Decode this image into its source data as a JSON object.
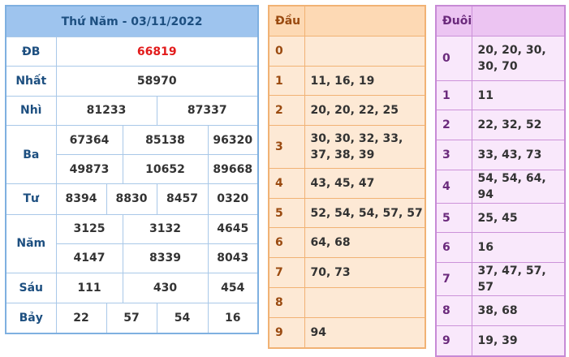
{
  "colors": {
    "special_prize": "#e21b1b",
    "main_header": "#9ec4ee",
    "dau_bg": "#fde9d5",
    "duoi_bg": "#f9e8fb"
  },
  "results": {
    "title": "Thứ Năm - 03/11/2022",
    "labels": [
      "ĐB",
      "Nhất",
      "Nhì",
      "Ba",
      "Tư",
      "Năm",
      "Sáu",
      "Bảy"
    ],
    "db": "66819",
    "nhat": "58970",
    "nhi": [
      "81233",
      "87337"
    ],
    "ba": [
      "67364",
      "85138",
      "96320",
      "49873",
      "10652",
      "89668"
    ],
    "tu": [
      "8394",
      "8830",
      "8457",
      "0320"
    ],
    "nam": [
      "3125",
      "3132",
      "4645",
      "4147",
      "8339",
      "8043"
    ],
    "sau": [
      "111",
      "430",
      "454"
    ],
    "bay": [
      "22",
      "57",
      "54",
      "16"
    ]
  },
  "dau": {
    "header": "Đầu",
    "rows": [
      {
        "k": "0",
        "v": ""
      },
      {
        "k": "1",
        "v": "11, 16, 19"
      },
      {
        "k": "2",
        "v": "20, 20, 22, 25"
      },
      {
        "k": "3",
        "v": "30, 30, 32, 33, 37, 38, 39"
      },
      {
        "k": "4",
        "v": "43, 45, 47"
      },
      {
        "k": "5",
        "v": "52, 54, 54, 57, 57"
      },
      {
        "k": "6",
        "v": "64, 68"
      },
      {
        "k": "7",
        "v": "70, 73"
      },
      {
        "k": "8",
        "v": ""
      },
      {
        "k": "9",
        "v": "94"
      }
    ]
  },
  "duoi": {
    "header": "Đuôi",
    "rows": [
      {
        "k": "0",
        "v": "20, 20, 30, 30, 70"
      },
      {
        "k": "1",
        "v": "11"
      },
      {
        "k": "2",
        "v": "22, 32, 52"
      },
      {
        "k": "3",
        "v": "33, 43, 73"
      },
      {
        "k": "4",
        "v": "54, 54, 64, 94"
      },
      {
        "k": "5",
        "v": "25, 45"
      },
      {
        "k": "6",
        "v": "16"
      },
      {
        "k": "7",
        "v": "37, 47, 57, 57"
      },
      {
        "k": "8",
        "v": "38, 68"
      },
      {
        "k": "9",
        "v": "19, 39"
      }
    ]
  }
}
